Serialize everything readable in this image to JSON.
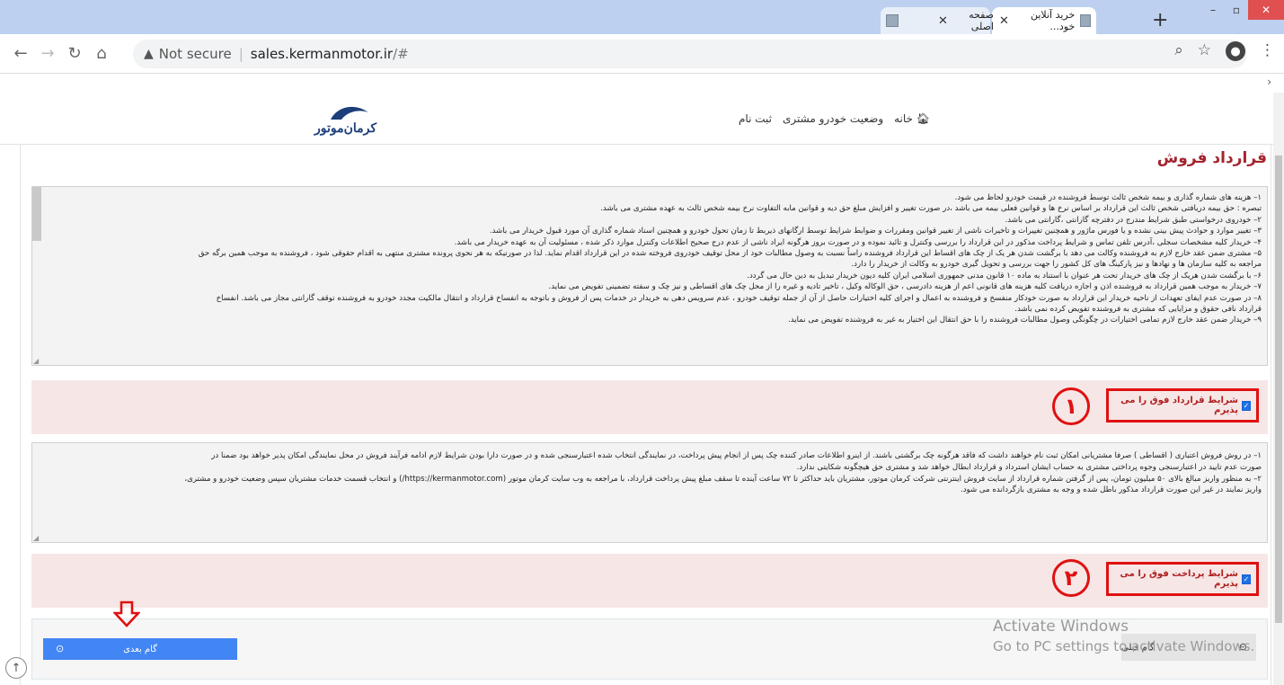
{
  "browser": {
    "tabs": [
      {
        "title": "",
        "active": false
      },
      {
        "title": "خرید آنلاین خود...",
        "active": true
      },
      {
        "title": "صفحه اصلی",
        "active": false
      }
    ],
    "new_tab_label": "+",
    "address": {
      "security_label": "Not secure",
      "url_host": "sales.kermanmotor.ir",
      "url_path": "/#"
    }
  },
  "site": {
    "logo_text": "کرمان‌موتور",
    "nav": {
      "home": "خانه",
      "status": "وضعیت خودرو مشتری",
      "register": "ثبت نام"
    },
    "page_title": "قرارداد فروش",
    "contract_lines": [
      "۱– هزینه های شماره گذاری و بیمه شخص ثالث توسط فروشنده در قیمت خودرو لحاظ می شود.",
      "تبصره : حق بیمه دریافتی شخص ثالث این قرارداد بر اساس نرخ ها و قوانین فعلی بیمه می باشد ،در صورت تغییر و افزایش مبلغ حق دیه و قوانین مابه التفاوت نرخ بیمه شخص ثالث به عهده مشتری می باشد.",
      "۲– خودروی درخواستی طبق شرایط مندرج در دفترچه گارانتی ،گارانتی می باشد.",
      "۳– تغییر موارد و حوادث پیش بینی نشده و یا فورس ماژور و همچنین تغییرات و تاخیرات ناشی از تغییر قوانین ومقررات و ضوابط شرایط توسط ارگانهای ذیربط تا زمان تحول خودرو و همچنین اسناد شماره گذاری آن مورد قبول خریدار می باشد.",
      "۴– خریدار کلیه مشخصات سجلی ،آدرس تلفن تماس و شرایط پرداخت مذکور در این قرارداد را بررسی وکنترل و تائید نموده و در صورت بروز هرگونه ایراد ناشی از عدم درج صحیح اطلاعات وکنترل موارد ذکر شده ، مسئولیت آن به عهده خریدار می باشد.",
      "۵– مشتری ضمن عقد خارج لازم به فروشنده وکالت می دهد با برگشت شدن هر یک از چک های اقساط این قرارداد فروشنده راساً نسبت به وصول مطالبات خود از محل توقیف خودروی فروخته شده در این قرارداد اقدام نماید. لذا در صورتیکه به هر نحوی پرونده مشتری منتهی به اقدام حقوقی شود ، فروشنده به موجب همین برگه حق",
      "مراجعه به کلیه سازمان ها و نهادها و نیز پارکینگ های کل کشور را جهت بررسی و تحویل گیری خودرو به وکالت از خریدار را دارد.",
      "۶– با برگشت شدن هریک از چک های خریدار تحت هر عنوان با استناد به ماده ۱۰ قانون مدنی جمهوری اسلامی ایران کلیه دیون خریدار تبدیل به دین حال می گردد.",
      "۷– خریدار به موجب همین قرارداد به فروشنده اذن و اجازه دریافت کلیه هزینه های قانونی اعم از هزینه دادرسی ، حق الوکاله وکیل ، تاخیر تادیه و غیره را از محل چک های اقساطی و نیز چک و سفته تضمینی تفویض می نماید.",
      "۸– در صورت عدم ایفای تعهدات از ناحیه خریدار این قرارداد به صورت خودکار منفسخ و فروشنده به اعمال و اجرای کلیه اختیارات حاصل از آن از جمله توقیف خودرو ، عدم سرویس دهی به خریدار در خدمات پس از فروش و باتوجه به انفساخ قرارداد و انتقال مالکیت مجدد خودرو به فروشنده توقف گارانتی مجاز می باشد. انفساخ",
      "قرارداد نافی حقوق و مزایایی که مشتری به فروشنده تفویض کرده نمی باشد.",
      "۹– خریدار ضمن عقد خارج لازم تمامی اختیارات در چگونگی وصول مطالبات فروشنده را با حق انتقال این اختیار به غیر به فروشنده تفویض می نماید."
    ],
    "accept_contract_label": "شرایط قرارداد فوق را می پذیرم",
    "payment_lines": [
      "۱– در روش فروش اعتباری ( اقساطی ) صرفا مشتریانی امکان ثبت نام خواهند داشت که فاقد هرگونه چک برگشتی باشند. از اینرو اطلاعات صادر کننده چک پس از انجام پیش پرداخت، در نمایندگی انتخاب شده اعتبارسنجی شده و در صورت دارا بودن شرایط لازم ادامه فرآیند فروش در محل نمایندگی امکان پذیر خواهد بود ضمنا در",
      "صورت عدم تایید در اعتبارسنجی وجوه پرداختی مشتری به حساب ایشان استرداد و قرارداد ابطال خواهد شد و مشتری حق هیچگونه شکایتی ندارد.",
      "۲– به منظور واریز مبالغ بالای ۵۰ میلیون تومان، پس از گرفتن شماره قرارداد از سایت فروش اینترنتی شرکت کرمان موتور، مشتریان باید حداکثر تا ۷۲ ساعت آینده تا سقف مبلغ پیش پرداخت قرارداد، با مراجعه به وب سایت کرمان موتور (https://kermanmotor.com/) و انتخاب قسمت خدمات مشتریان سپس وضعیت خودرو و مشتری،",
      "واریز نمایند در غیر این صورت قرارداد مذکور باطل شده و وجه به مشتری بازگردانده می شود."
    ],
    "accept_payment_label": "شرایط پرداخت فوق را می پذیرم",
    "annotation_1": "۱",
    "annotation_2": "۲",
    "next_button": "گام بعدی",
    "prev_button": "گام قبلی"
  },
  "os_watermark": {
    "line1": "Activate Windows",
    "line2": "Go to PC settings to activate Windows."
  }
}
